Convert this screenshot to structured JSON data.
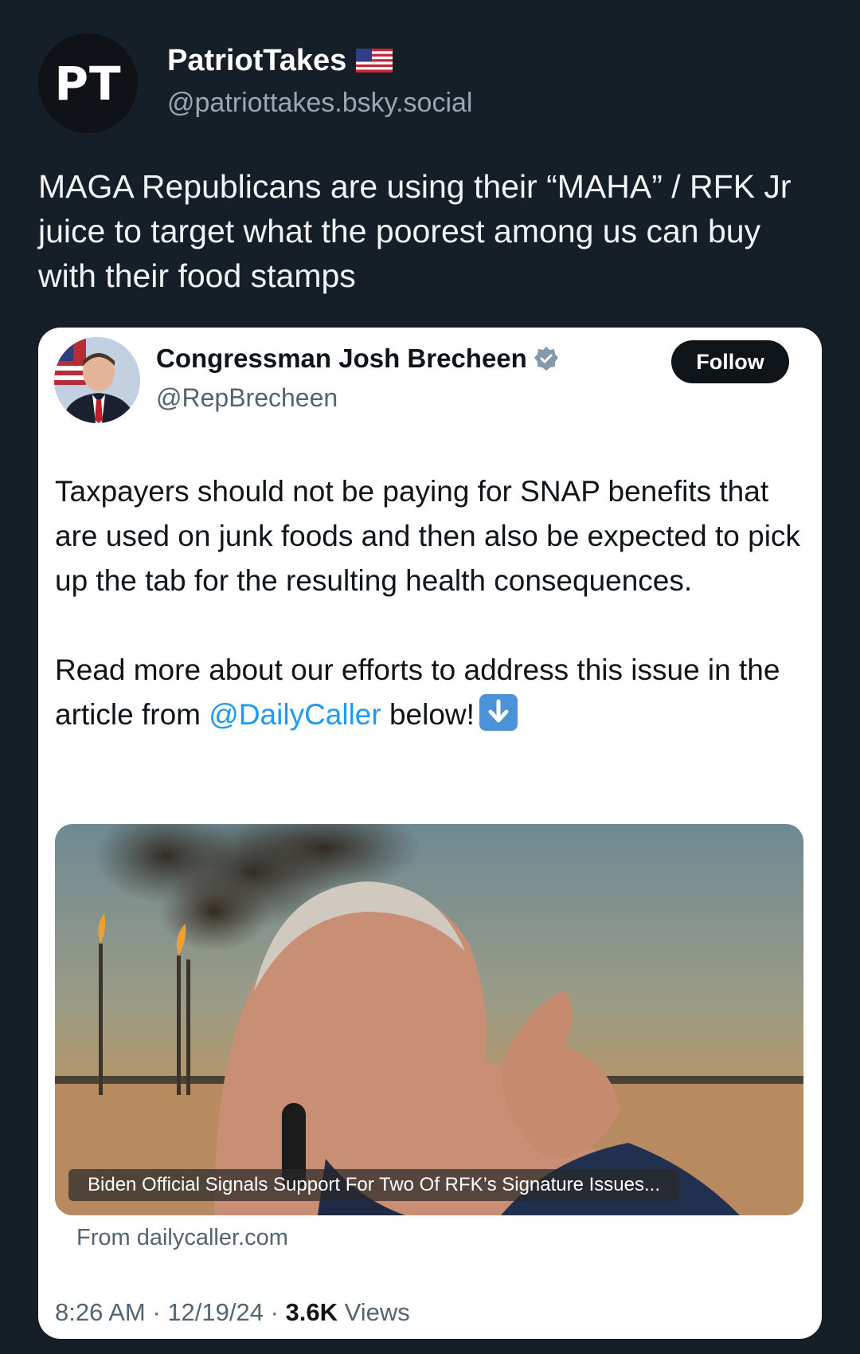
{
  "post": {
    "avatar_initials": "PT",
    "author_name": "PatriotTakes",
    "author_handle": "@patriottakes.bsky.social",
    "text": "MAGA Republicans are using their “MAHA” / RFK Jr juice to target what the poorest among us can buy with their food stamps"
  },
  "embedded_tweet": {
    "name": "Congressman Josh Brecheen",
    "handle": "@RepBrecheen",
    "follow_label": "Follow",
    "paragraph1": "Taxpayers should not be paying for SNAP benefits that are used on junk foods and then also be expected to pick up the tab for the resulting health consequences.",
    "paragraph2_before": "Read more about our efforts to address this issue in the article from ",
    "paragraph2_mention": "@DailyCaller",
    "paragraph2_after": " below!",
    "article_caption": "Biden Official Signals Support For Two Of RFK’s Signature Issues...",
    "article_source": "From dailycaller.com",
    "time": "8:26 AM",
    "date": "12/19/24",
    "views_count": "3.6K",
    "views_label": "Views"
  },
  "colors": {
    "background": "#161e27",
    "mention": "#1d9bf0",
    "card": "#ffffff"
  }
}
